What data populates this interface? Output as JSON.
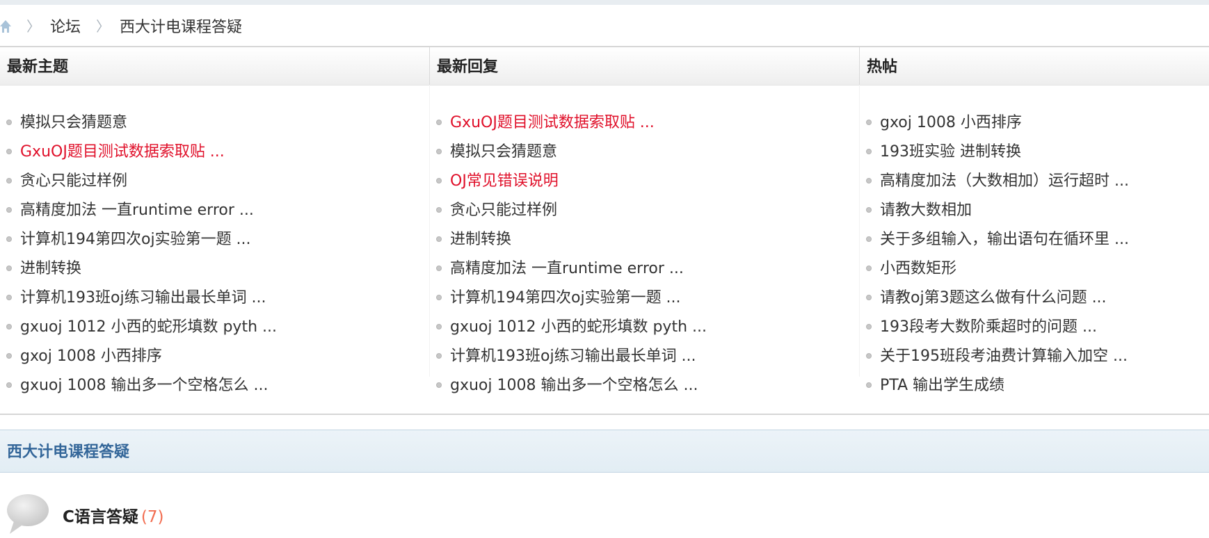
{
  "breadcrumb": {
    "home_icon": "home-icon",
    "separator": "〉",
    "items": [
      "论坛",
      "西大计电课程答疑"
    ]
  },
  "columns": [
    {
      "title": "最新主题",
      "items": [
        {
          "text": "模拟只会猜题意",
          "red": false
        },
        {
          "text": "GxuOJ题目测试数据索取贴 ...",
          "red": true
        },
        {
          "text": "贪心只能过样例",
          "red": false
        },
        {
          "text": "高精度加法 一直runtime error ...",
          "red": false
        },
        {
          "text": "计算机194第四次oj实验第一题 ...",
          "red": false
        },
        {
          "text": "进制转换",
          "red": false
        },
        {
          "text": "计算机193班oj练习输出最长单词 ...",
          "red": false
        },
        {
          "text": "gxuoj 1012 小西的蛇形填数 pyth ...",
          "red": false
        },
        {
          "text": "gxoj 1008 小西排序",
          "red": false
        },
        {
          "text": "gxuoj 1008 输出多一个空格怎么 ...",
          "red": false
        }
      ]
    },
    {
      "title": "最新回复",
      "items": [
        {
          "text": "GxuOJ题目测试数据索取贴 ...",
          "red": true
        },
        {
          "text": "模拟只会猜题意",
          "red": false
        },
        {
          "text": "OJ常见错误说明",
          "red": true
        },
        {
          "text": "贪心只能过样例",
          "red": false
        },
        {
          "text": "进制转换",
          "red": false
        },
        {
          "text": "高精度加法 一直runtime error ...",
          "red": false
        },
        {
          "text": "计算机194第四次oj实验第一题 ...",
          "red": false
        },
        {
          "text": "gxuoj 1012 小西的蛇形填数 pyth ...",
          "red": false
        },
        {
          "text": "计算机193班oj练习输出最长单词 ...",
          "red": false
        },
        {
          "text": "gxuoj 1008 输出多一个空格怎么 ...",
          "red": false
        }
      ]
    },
    {
      "title": "热帖",
      "items": [
        {
          "text": "gxoj 1008 小西排序",
          "red": false
        },
        {
          "text": "193班实验 进制转换",
          "red": false
        },
        {
          "text": "高精度加法（大数相加）运行超时 ...",
          "red": false
        },
        {
          "text": "请教大数相加",
          "red": false
        },
        {
          "text": "关于多组输入，输出语句在循环里 ...",
          "red": false
        },
        {
          "text": "小西数矩形",
          "red": false
        },
        {
          "text": "请教oj第3题这么做有什么问题 ...",
          "red": false
        },
        {
          "text": "193段考大数阶乘超时的问题 ...",
          "red": false
        },
        {
          "text": "关于195班段考油费计算输入加空 ...",
          "red": false
        },
        {
          "text": "PTA 输出学生成绩",
          "red": false
        }
      ]
    }
  ],
  "forum_section": {
    "title": "西大计电课程答疑",
    "subforum": {
      "name": "C语言答疑",
      "count": "(7)",
      "icon": "speech-bubble-icon"
    }
  },
  "colors": {
    "red_link": "#e0102a",
    "section_title": "#336699",
    "count": "#f26c4f"
  }
}
